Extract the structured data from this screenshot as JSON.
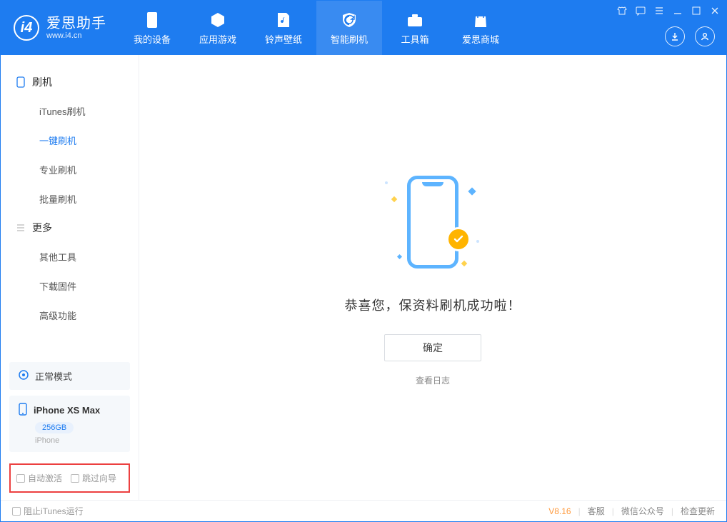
{
  "app": {
    "title": "爱思助手",
    "subtitle": "www.i4.cn"
  },
  "nav": {
    "my_device": "我的设备",
    "apps_games": "应用游戏",
    "ring_wall": "铃声壁纸",
    "smart_flash": "智能刷机",
    "toolbox": "工具箱",
    "store": "爱思商城"
  },
  "sidebar": {
    "group_flash": "刷机",
    "items_flash": {
      "itunes": "iTunes刷机",
      "onekey": "一键刷机",
      "pro": "专业刷机",
      "batch": "批量刷机"
    },
    "group_more": "更多",
    "items_more": {
      "other_tools": "其他工具",
      "download_fw": "下载固件",
      "advanced": "高级功能"
    },
    "status_label": "正常模式",
    "device_name": "iPhone XS Max",
    "device_capacity": "256GB",
    "device_type": "iPhone",
    "chk_auto_activate": "自动激活",
    "chk_skip_guide": "跳过向导"
  },
  "main": {
    "success_text": "恭喜您，保资料刷机成功啦！",
    "ok_button": "确定",
    "view_log": "查看日志"
  },
  "footer": {
    "stop_itunes": "阻止iTunes运行",
    "version": "V8.16",
    "service": "客服",
    "wechat": "微信公众号",
    "update": "检查更新"
  }
}
